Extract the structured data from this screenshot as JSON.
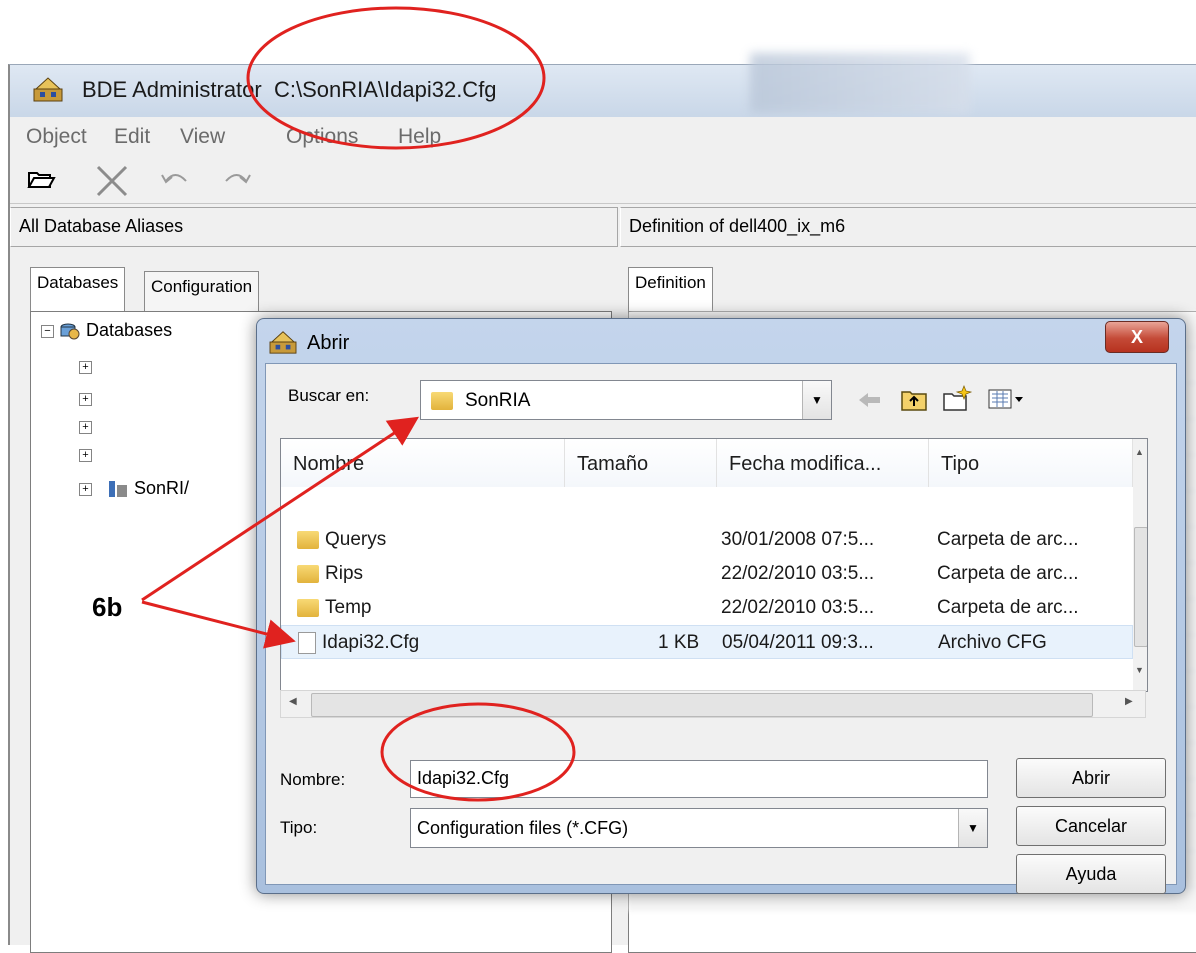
{
  "bde": {
    "app_title": "BDE Administrator",
    "config_path": "C:\\SonRIA\\Idapi32.Cfg",
    "menu": [
      "Object",
      "Edit",
      "View",
      "Options",
      "Help"
    ],
    "left_header": "All Database Aliases",
    "right_header": "Definition of dell400_ix_m6",
    "left_tabs": [
      "Databases",
      "Configuration"
    ],
    "right_tabs": [
      "Definition"
    ],
    "tree_root": "Databases",
    "tree_item": "SonRI/",
    "toolbar_icons": [
      "open-folder-icon",
      "delete-icon",
      "undo-icon",
      "redo-icon"
    ]
  },
  "dialog": {
    "title": "Abrir",
    "close_label": "X",
    "lookin_label": "Buscar en:",
    "lookin_value": "SonRIA",
    "columns": [
      "Nombre",
      "Tamaño",
      "Fecha modifica...",
      "Tipo"
    ],
    "files": [
      {
        "name": "Querys",
        "size": "",
        "date": "30/01/2008 07:5...",
        "type": "Carpeta de arc...",
        "icon": "folder-icon"
      },
      {
        "name": "Rips",
        "size": "",
        "date": "22/02/2010 03:5...",
        "type": "Carpeta de arc...",
        "icon": "folder-icon"
      },
      {
        "name": "Temp",
        "size": "",
        "date": "22/02/2010 03:5...",
        "type": "Carpeta de arc...",
        "icon": "folder-icon"
      },
      {
        "name": "Idapi32.Cfg",
        "size": "1 KB",
        "date": "05/04/2011 09:3...",
        "type": "Archivo CFG",
        "icon": "file-icon"
      }
    ],
    "name_label": "Nombre:",
    "name_value": "Idapi32.Cfg",
    "type_label": "Tipo:",
    "type_value": "Configuration files (*.CFG)",
    "buttons": {
      "open": "Abrir",
      "cancel": "Cancelar",
      "help": "Ayuda"
    }
  },
  "annotation": {
    "label": "6b",
    "color": "#e0221f"
  }
}
